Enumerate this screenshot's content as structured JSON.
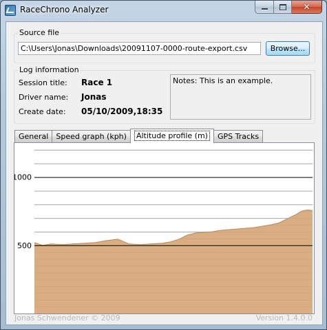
{
  "window": {
    "title": "RaceChrono Analyzer",
    "close_glyph": "✕"
  },
  "source": {
    "group_label": "Source file",
    "file_path": "C:\\Users\\Jonas\\Downloads\\20091107-0000-route-export.csv",
    "browse_label": "Browse..."
  },
  "log": {
    "group_label": "Log information",
    "session_label": "Session title:",
    "session_value": "Race 1",
    "driver_label": "Driver name:",
    "driver_value": "Jonas",
    "date_label": "Create date:",
    "date_value": "05/10/2009,18:35",
    "notes": "Notes: This is an example."
  },
  "tabs": [
    {
      "label": "General"
    },
    {
      "label": "Speed graph (kph)"
    },
    {
      "label": "Altitude profile (m)"
    },
    {
      "label": "GPS Tracks"
    }
  ],
  "status": {
    "author": "Jonas Schwendener © 2009",
    "version": "Version 1.4.0.0"
  },
  "chart_data": {
    "type": "area",
    "title": "",
    "xlabel": "",
    "ylabel": "",
    "ylim": [
      0,
      1250
    ],
    "tick_values": [
      500,
      1000
    ],
    "tick_labels": [
      "500",
      "1000"
    ],
    "grid": true,
    "fill_color": "#d8ae82",
    "fill_line_color": "#b38a5e",
    "grid_color": "#a9a9a9",
    "major_line_color": "#000000",
    "x": [
      0,
      0.03,
      0.06,
      0.1,
      0.14,
      0.18,
      0.22,
      0.26,
      0.3,
      0.34,
      0.38,
      0.42,
      0.46,
      0.49,
      0.52,
      0.55,
      0.58,
      0.61,
      0.64,
      0.67,
      0.7,
      0.73,
      0.76,
      0.79,
      0.82,
      0.85,
      0.88,
      0.9,
      0.92,
      0.94,
      0.96,
      0.98,
      1.0
    ],
    "values": [
      520,
      500,
      510,
      505,
      510,
      515,
      520,
      535,
      545,
      510,
      505,
      510,
      515,
      525,
      545,
      575,
      590,
      595,
      600,
      610,
      615,
      620,
      625,
      630,
      640,
      650,
      665,
      685,
      705,
      725,
      750,
      760,
      755
    ]
  }
}
